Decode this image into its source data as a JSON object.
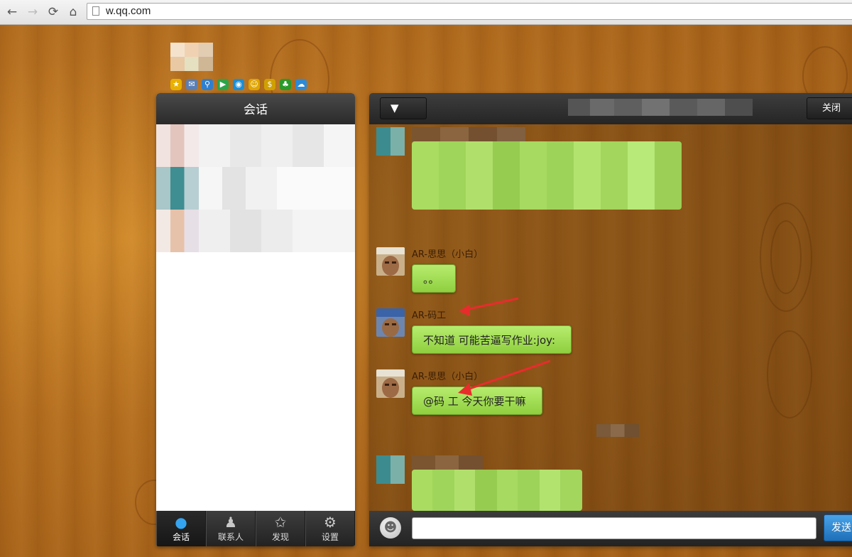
{
  "browser": {
    "url": "w.qq.com",
    "back_icon": "←",
    "forward_icon": "→",
    "reload_icon": "⟳",
    "home_icon": "⌂"
  },
  "app_icons": [
    {
      "name": "star-icon",
      "glyph": "★",
      "color": "#e8b000"
    },
    {
      "name": "mail-icon",
      "glyph": "✉",
      "color": "#5b7fb5"
    },
    {
      "name": "search-icon",
      "glyph": "⚲",
      "color": "#2f7fd0"
    },
    {
      "name": "video-icon",
      "glyph": "▶",
      "color": "#2aa54a"
    },
    {
      "name": "browser-icon",
      "glyph": "◉",
      "color": "#1b8ed8"
    },
    {
      "name": "smile-icon",
      "glyph": "☺",
      "color": "#e0a500"
    },
    {
      "name": "money-icon",
      "glyph": "$",
      "color": "#d0a000"
    },
    {
      "name": "clover-icon",
      "glyph": "♣",
      "color": "#2a9a2a"
    },
    {
      "name": "cloud-icon",
      "glyph": "☁",
      "color": "#2b8bd8"
    }
  ],
  "left_panel": {
    "title": "会话",
    "tabs": [
      {
        "label": "会话",
        "icon": "chat-bubble-icon",
        "glyph": "●"
      },
      {
        "label": "联系人",
        "icon": "contact-icon",
        "glyph": "♟"
      },
      {
        "label": "发现",
        "icon": "discover-star-icon",
        "glyph": "✩"
      },
      {
        "label": "设置",
        "icon": "settings-gear-icon",
        "glyph": "⚙"
      }
    ]
  },
  "chat": {
    "dropdown_label": "▼",
    "close_label": "关闭",
    "messages": [
      {
        "sender": "AR-思思（小白）",
        "text": "。。"
      },
      {
        "sender": "AR-码工",
        "text": "不知道 可能苦逼写作业:joy:"
      },
      {
        "sender": "AR-思思（小白）",
        "text": "@码 工 今天你要干嘛"
      }
    ],
    "send_label": "发送",
    "emoji_glyph": "☻"
  }
}
